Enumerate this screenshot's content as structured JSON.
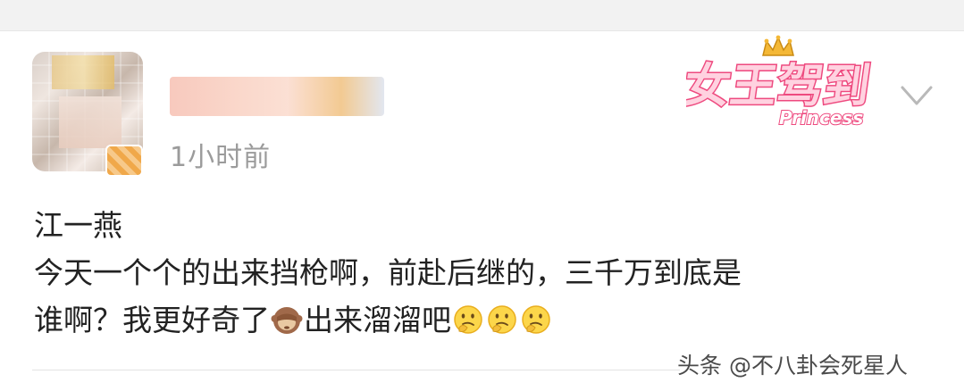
{
  "post": {
    "timestamp": "1小时前",
    "content": {
      "line1": "江一燕",
      "line2": "今天一个个的出来挡枪啊，前赴后继的，三千万到底是",
      "line3_part1": "谁啊？我更好奇了",
      "line3_part2": "出来溜溜吧"
    },
    "inline_emojis": [
      "see-no-evil-monkey-icon",
      "thinking-face-icon",
      "thinking-face-icon",
      "thinking-face-icon"
    ]
  },
  "badge": {
    "main_text": "女王驾到",
    "sub_text": "Princess",
    "colors": {
      "pink": "#ee4a7f",
      "light_pink": "#ffd2e0",
      "gold": "#f4b836"
    }
  },
  "watermark": {
    "text": "头条 @不八卦会死星人"
  },
  "colors": {
    "timestamp": "#9b9b9b",
    "body_text": "#222222",
    "top_strip": "#f2f2f2"
  }
}
